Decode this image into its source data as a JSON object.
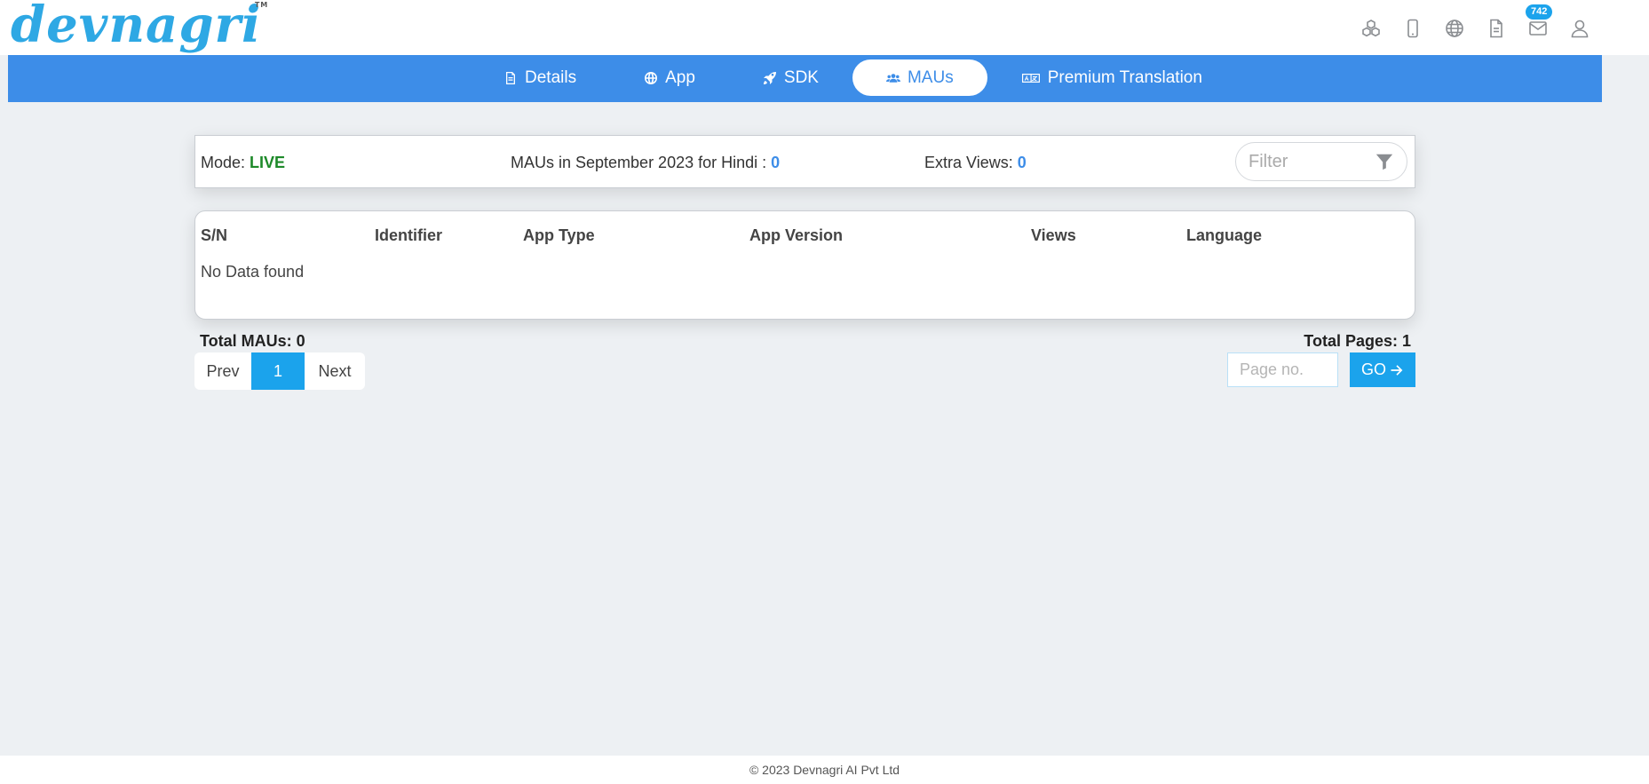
{
  "header": {
    "logo_text": "devnagri",
    "logo_tm": "TM",
    "icons": [
      "cubes-icon",
      "mobile-icon",
      "globe-icon",
      "file-icon",
      "mail-icon",
      "user-icon"
    ],
    "mail_badge": "742"
  },
  "nav": {
    "tabs": [
      {
        "label": "Details",
        "icon": "file-text-icon",
        "active": false
      },
      {
        "label": "App",
        "icon": "globe-icon",
        "active": false
      },
      {
        "label": "SDK",
        "icon": "rocket-icon",
        "active": false
      },
      {
        "label": "MAUs",
        "icon": "users-icon",
        "active": true
      },
      {
        "label": "Premium Translation",
        "icon": "translate-icon",
        "active": false
      }
    ]
  },
  "info": {
    "mode_label": "Mode: ",
    "mode_value": "LIVE",
    "maus_label": "MAUs in September 2023 for Hindi : ",
    "maus_value": "0",
    "extra_label": "Extra Views: ",
    "extra_value": "0",
    "filter_placeholder": "Filter"
  },
  "table": {
    "headers": [
      "S/N",
      "Identifier",
      "App Type",
      "App Version",
      "Views",
      "Language"
    ],
    "empty_text": "No Data found"
  },
  "pagination": {
    "total_maus": "Total MAUs: 0",
    "total_pages": "Total Pages: 1",
    "prev": "Prev",
    "current": "1",
    "next": "Next",
    "page_placeholder": "Page no.",
    "go_label": "GO"
  },
  "footer": {
    "text": "© 2023 Devnagri AI Pvt Ltd"
  },
  "colors": {
    "accent": "#3d8de8",
    "button": "#1ba3ec",
    "live": "#1e8a2a",
    "background": "#edf0f3"
  }
}
